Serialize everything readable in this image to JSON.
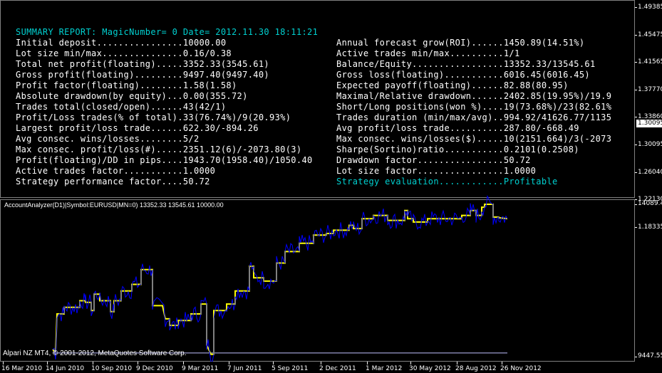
{
  "report": {
    "title": "SUMMARY REPORT: MagicNumber= 0 Date= 2012.11.30 18:11:21",
    "left": [
      "Initial deposit................10000.00",
      "Lot size min/max...............0.16/0.38",
      "Total net profit(floating).....3352.33(3545.61)",
      "Gross profit(floating).........9497.40(9497.40)",
      "Profit factor(floating)........1.58(1.58)",
      "Absolute drawdown(by equity)...0.00(355.72)",
      "Trades total(closed/open)......43(42/1)",
      "Profit/Loss trades(% of total).33(76.74%)/9(20.93%)",
      "Largest profit/loss trade......622.30/-894.26",
      "Avg consec. wins/losses........5/2",
      "Max consec. profit/loss(#).....2351.12(6)/-2073.80(3)",
      "Profit(floating)/DD in pips....1943.70(1958.40)/1050.40",
      "Active trades factor...........1.0000",
      "Strategy performance factor....50.72"
    ],
    "right": [
      "Annual forecast grow(ROI)......1450.89(14.51%)",
      "Active trades min/max..........1/1",
      "Balance/Equity.................13352.33/13545.61",
      "Gross loss(floating)...........6016.45(6016.45)",
      "Expected payoff(floating)......82.88(80.95)",
      "Maximal/Relative drawdown......2402.85(19.95%)/19.9",
      "Short/Long positions(won %)....19(73.68%)/23(82.61%",
      "Trades duration (min/max/avg)..994.92/41626.77/1135",
      "Avg profit/loss trade..........287.80/-668.49",
      "Max consec. wins/losses($).....10(2151.664)/3(-2073",
      "Sharpe(Sortino)ratio...........0.2101(0.2508)",
      "Drawdown factor................50.72",
      "Lot size factor................1.0000",
      "Strategy evaluation............Profitable"
    ]
  },
  "price_scale": [
    "1.49385",
    "1.45475",
    "1.41565",
    "1.37770",
    "1.33860",
    "1.30095",
    "1.26040",
    "1.22130",
    "1.18335"
  ],
  "current_price": "1.30095",
  "indicator": {
    "label": "AccountAnalyzer(D1)|Symbol:EURUSD|MN=0) 13352.33 13545.61 10000.00",
    "scale_top": "14089.4",
    "scale_bottom": "9447.55"
  },
  "copyright": "Alpari NZ MT4, © 2001-2012, MetaQuotes Software Corp.",
  "x_labels": [
    "16 Mar 2010",
    "14 Jun 2010",
    "10 Sep 2010",
    "9 Dec 2010",
    "9 Mar 2011",
    "7 Jun 2011",
    "5 Sep 2011",
    "2 Dec 2011",
    "1 Mar 2012",
    "30 May 2012",
    "28 Aug 2012",
    "26 Nov 2012"
  ],
  "colors": {
    "balance": "#ffff00",
    "equity": "#0000ff",
    "baseline": "#c0c0ff",
    "report_title": "#00d0d0",
    "strategy_eval": "#00d0d0"
  },
  "chart_data": {
    "type": "line",
    "title": "",
    "ylim": [
      9447.55,
      14089.4
    ],
    "series": [
      {
        "name": "",
        "points": [
          [
            74,
            9670
          ],
          [
            78,
            9560
          ],
          [
            80,
            10750
          ],
          [
            90,
            10750
          ],
          [
            90,
            10950
          ],
          [
            112,
            10950
          ],
          [
            112,
            11150
          ],
          [
            120,
            11150
          ],
          [
            120,
            11100
          ],
          [
            128,
            11100
          ],
          [
            128,
            10850
          ],
          [
            132,
            10850
          ],
          [
            132,
            11350
          ],
          [
            140,
            11350
          ],
          [
            140,
            11150
          ],
          [
            155,
            11150
          ],
          [
            155,
            10820
          ],
          [
            160,
            10820
          ],
          [
            160,
            11150
          ],
          [
            170,
            11150
          ],
          [
            170,
            11450
          ],
          [
            185,
            11450
          ],
          [
            185,
            11650
          ],
          [
            198,
            11650
          ],
          [
            198,
            12100
          ],
          [
            214,
            12100
          ],
          [
            214,
            11000
          ],
          [
            228,
            11000
          ],
          [
            232,
            10600
          ],
          [
            238,
            10600
          ],
          [
            238,
            10400
          ],
          [
            250,
            10400
          ],
          [
            250,
            10550
          ],
          [
            268,
            10550
          ],
          [
            268,
            10750
          ],
          [
            282,
            10750
          ],
          [
            282,
            11050
          ],
          [
            290,
            11050
          ],
          [
            290,
            9800
          ],
          [
            296,
            9520
          ],
          [
            300,
            9520
          ],
          [
            300,
            10850
          ],
          [
            318,
            10850
          ],
          [
            318,
            11050
          ],
          [
            330,
            11050
          ],
          [
            330,
            11450
          ],
          [
            350,
            11450
          ],
          [
            350,
            12200
          ],
          [
            356,
            12200
          ],
          [
            356,
            11850
          ],
          [
            370,
            11850
          ],
          [
            370,
            11750
          ],
          [
            388,
            11750
          ],
          [
            388,
            12300
          ],
          [
            400,
            12300
          ],
          [
            400,
            12650
          ],
          [
            420,
            12650
          ],
          [
            420,
            12900
          ],
          [
            440,
            12900
          ],
          [
            440,
            13150
          ],
          [
            458,
            13150
          ],
          [
            458,
            13200
          ],
          [
            468,
            13200
          ],
          [
            468,
            13300
          ],
          [
            490,
            13300
          ],
          [
            490,
            13450
          ],
          [
            496,
            13450
          ],
          [
            496,
            13350
          ],
          [
            508,
            13350
          ],
          [
            508,
            13650
          ],
          [
            524,
            13650
          ],
          [
            524,
            13750
          ],
          [
            544,
            13750
          ],
          [
            544,
            13600
          ],
          [
            568,
            13600
          ],
          [
            568,
            13900
          ],
          [
            572,
            13900
          ],
          [
            572,
            13650
          ],
          [
            580,
            13650
          ],
          [
            580,
            13550
          ],
          [
            600,
            13550
          ],
          [
            600,
            13650
          ],
          [
            648,
            13650
          ],
          [
            648,
            13750
          ],
          [
            660,
            13750
          ],
          [
            660,
            13900
          ],
          [
            668,
            13900
          ],
          [
            668,
            13750
          ],
          [
            676,
            13750
          ],
          [
            676,
            14000
          ],
          [
            680,
            14000
          ],
          [
            680,
            14089
          ],
          [
            692,
            14089
          ],
          [
            692,
            13700
          ],
          [
            700,
            13700
          ],
          [
            700,
            13680
          ],
          [
            712,
            13650
          ]
        ]
      },
      {
        "name": "",
        "points": [
          [
            74,
            9560
          ],
          [
            712,
            9560
          ]
        ]
      }
    ]
  }
}
